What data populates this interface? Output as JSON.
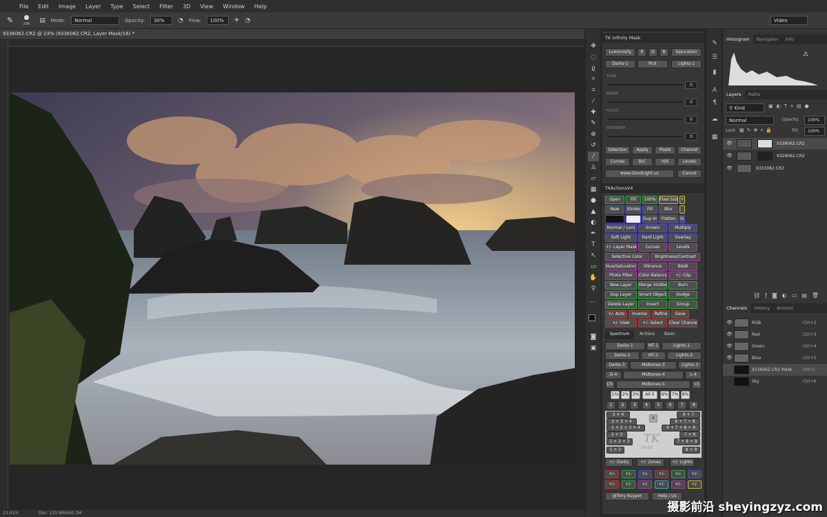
{
  "app_logo": "Ps",
  "menu": [
    "File",
    "Edit",
    "Image",
    "Layer",
    "Type",
    "Select",
    "Filter",
    "3D",
    "View",
    "Window",
    "Help"
  ],
  "options": {
    "brush_size": "208",
    "mode_label": "Mode:",
    "mode_value": "Normal",
    "opacity_label": "Opacity:",
    "opacity_value": "30%",
    "flow_label": "Flow:",
    "flow_value": "100%",
    "workspace": "Video"
  },
  "document_tab": "9336062.CR2 @ 23% (9336062.CR2, Layer Mask/16) *",
  "status": {
    "zoom": "23.01%",
    "doc": "Doc: 120.9M/440.3M"
  },
  "tk_infinity": {
    "title": "TK Infinity Mask",
    "row1": [
      "Luminosity",
      "R",
      "G",
      "B",
      "Saturation"
    ],
    "row2": [
      "Darks-1",
      "Pick",
      "Lights-1"
    ],
    "sliders": [
      {
        "label": "TONE",
        "value": "0"
      },
      {
        "label": "RANGE",
        "value": "0"
      },
      {
        "label": "FOCUS",
        "value": "0"
      },
      {
        "label": "STRENGTH",
        "value": "0"
      }
    ],
    "row3": [
      "Selection",
      "Apply",
      "Pixels",
      "Channel"
    ],
    "row4": [
      "Curves",
      "B/C",
      "H/S",
      "Levels"
    ],
    "row5": [
      "www.GoodLight.us",
      "Cancel"
    ]
  },
  "tk_actions": {
    "title": "TKActionsV4",
    "rows": [
      [
        "Open",
        "Fill",
        "100%",
        "Pixel Size",
        "+"
      ],
      [
        "New",
        "Stroke",
        "Fill",
        "Blur",
        ""
      ],
      [
        "",
        "",
        "Dup Image",
        "Flatten",
        "Size"
      ],
      [
        "Normal / Lum",
        "Screen",
        "Multiply"
      ],
      [
        "Soft Light",
        "Hard Light",
        "Overlay"
      ],
      [
        "+/- Layer Mask",
        "Curves",
        "Levels"
      ],
      [
        "Selective Color",
        "Brightness/Contrast"
      ],
      [
        "Hue/Saturation",
        "Vibrance",
        "B&W"
      ],
      [
        "Photo Filter",
        "Color Balance",
        "+/- Clip"
      ],
      [
        "New Layer",
        "Merge Visible",
        "Burn"
      ],
      [
        "Dup Layer",
        "Smart Object",
        "Dodge"
      ],
      [
        "Delete Layer",
        "Invert",
        "Group"
      ],
      [
        "+/- Ants",
        "Inverse",
        "Refine",
        "Save"
      ],
      [
        "+/- View",
        "+/- Select",
        "Clear Channels"
      ]
    ]
  },
  "spectrum": {
    "tabs": [
      "Spectrum",
      "Actions",
      "Basic"
    ],
    "rows": [
      [
        "Darks-1",
        "MT-1",
        "Lights-1"
      ],
      [
        "Darks-2",
        "MT-2",
        "Lights-2"
      ],
      [
        "Darks-3",
        "Midtones-3",
        "Lights-3"
      ],
      [
        "D-4",
        "Midtones-4",
        "L-4"
      ],
      [
        "D5",
        "Midtones-5",
        "L5"
      ]
    ],
    "zone_row": [
      "1%",
      "2%",
      "3%",
      "All-5",
      "6%",
      "7%",
      "8%"
    ],
    "digits": [
      "1",
      "2",
      "3",
      "4",
      "5",
      "6",
      "7",
      "8"
    ],
    "combo_left": [
      "3 + 4",
      "2 + 3 + 4",
      "1 + 2 + 3 + 4",
      "2 + 3",
      "1 + 2 + 3",
      "1 + 2"
    ],
    "combo_right": [
      "6 + 7",
      "6 + 7 + 8",
      "6 + 7 + 8 + 9",
      "7 + 8",
      "7 + 8 + 9",
      "8 + 9"
    ],
    "x_label": "X",
    "logo": "TK",
    "logo_sub": "16-bit",
    "bottom": [
      "+/- Darks",
      "+/- Zones",
      "+/- Lights"
    ],
    "pm": "+/-",
    "credit": [
      "@Tony Kuyper",
      "Help / Us"
    ]
  },
  "histogram_tabs": [
    "Histogram",
    "Navigator",
    "Info"
  ],
  "layers": {
    "tabs": [
      "Layers",
      "Paths"
    ],
    "kind": "Kind",
    "blend": "Normal",
    "opacity_label": "Opacity:",
    "opacity_value": "100%",
    "lock_label": "Lock:",
    "fill_label": "Fill:",
    "fill_value": "100%",
    "items": [
      {
        "name": "9336062.CR2"
      },
      {
        "name": "9329062.CR2"
      },
      {
        "name": "9333062.CR2"
      }
    ]
  },
  "channels": {
    "tabs": [
      "Channels",
      "History",
      "Actions"
    ],
    "items": [
      {
        "name": "RGB",
        "shortcut": "Ctrl+2"
      },
      {
        "name": "Red",
        "shortcut": "Ctrl+3"
      },
      {
        "name": "Green",
        "shortcut": "Ctrl+4"
      },
      {
        "name": "Blue",
        "shortcut": "Ctrl+5"
      },
      {
        "name": "9336062.CR2 Mask",
        "shortcut": "Ctrl+\\"
      },
      {
        "name": "Sky",
        "shortcut": "Ctrl+6"
      }
    ]
  },
  "watermark": "摄影前沿 sheyingzyz.com",
  "colors": {
    "accent": "#31a8ff",
    "tk_green": "#27a83a",
    "tk_blue": "#4a4ad8",
    "tk_purple": "#a33aa8",
    "tk_red": "#c03030",
    "tk_yellow": "#c8c020"
  }
}
